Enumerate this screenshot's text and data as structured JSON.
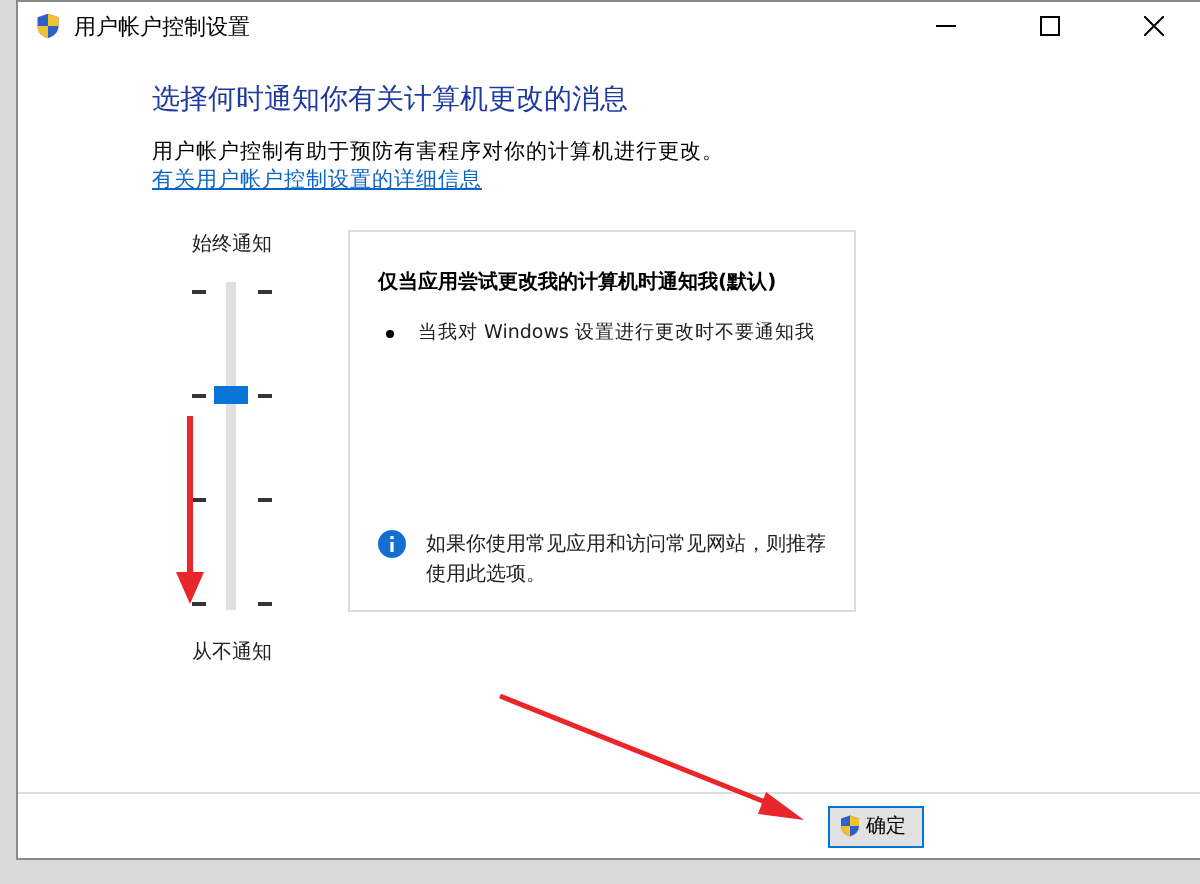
{
  "window": {
    "title": "用户帐户控制设置"
  },
  "heading": "选择何时通知你有关计算机更改的消息",
  "description": "用户帐户控制有助于预防有害程序对你的计算机进行更改。",
  "link": "有关用户帐户控制设置的详细信息",
  "slider": {
    "top_label": "始终通知",
    "bottom_label": "从不通知",
    "level": 0.667
  },
  "panel": {
    "title": "仅当应用尝试更改我的计算机时通知我(默认)",
    "bullets": [
      "当我对 Windows 设置进行更改时不要通知我"
    ],
    "info": "如果你使用常见应用和访问常见网站，则推荐使用此选项。"
  },
  "buttons": [
    {
      "label": "确定"
    }
  ]
}
